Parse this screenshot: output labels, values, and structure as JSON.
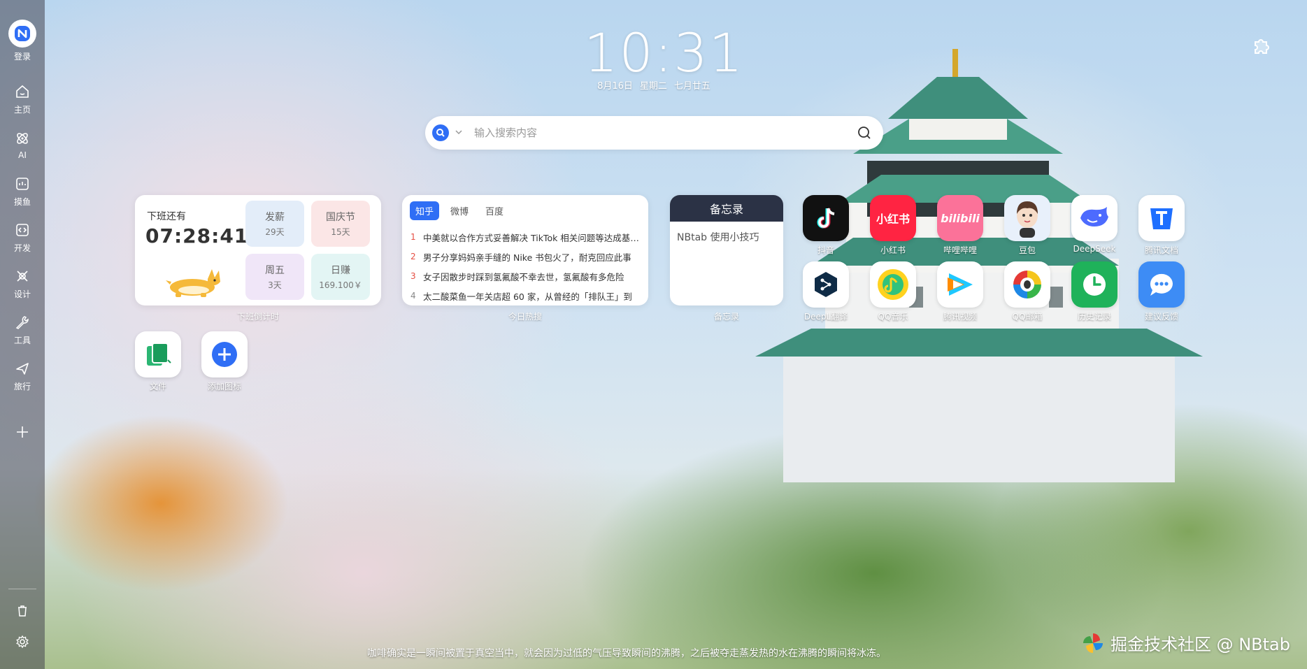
{
  "sidebar": {
    "login_label": "登录",
    "items": [
      {
        "label": "主页",
        "icon": "home-icon"
      },
      {
        "label": "AI",
        "icon": "ai-icon"
      },
      {
        "label": "摸鱼",
        "icon": "fish-icon"
      },
      {
        "label": "开发",
        "icon": "code-icon"
      },
      {
        "label": "设计",
        "icon": "design-icon"
      },
      {
        "label": "工具",
        "icon": "tool-icon"
      },
      {
        "label": "旅行",
        "icon": "plane-icon"
      }
    ]
  },
  "clock": {
    "time": "10:31",
    "date": "8月16日",
    "weekday": "星期二",
    "lunar": "七月廿五"
  },
  "search": {
    "placeholder": "输入搜索内容"
  },
  "countdown": {
    "label": "下班还有",
    "timer": "07:28:41",
    "tiles": [
      {
        "title": "发薪",
        "value": "29天",
        "bg": "#e3edf9"
      },
      {
        "title": "国庆节",
        "value": "15天",
        "bg": "#fbe6e6"
      },
      {
        "title": "周五",
        "value": "3天",
        "bg": "#f0e6f8"
      },
      {
        "title": "日赚",
        "value": "169.100￥",
        "bg": "#e3f5f4"
      }
    ],
    "caption": "下班倒计时"
  },
  "hot": {
    "tabs": [
      "知乎",
      "微博",
      "百度"
    ],
    "items": [
      {
        "num": "1",
        "text": "中美就以合作方式妥善解决 TikTok 相关问题等达成基本框架共识"
      },
      {
        "num": "2",
        "text": "男子分享妈妈亲手缝的 Nike 书包火了，耐克回应此事"
      },
      {
        "num": "3",
        "text": "女子因散步时踩到氢氟酸不幸去世，氢氟酸有多危险"
      },
      {
        "num": "4",
        "text": "太二酸菜鱼一年关店超 60 家，从曾经的「排队王」到"
      }
    ],
    "caption": "今日热搜"
  },
  "memo": {
    "title": "备忘录",
    "content": "NBtab 使用小技巧",
    "caption": "备忘录"
  },
  "apps": [
    {
      "name": "抖音",
      "bg": "#111111"
    },
    {
      "name": "小红书",
      "bg": "#ff2442"
    },
    {
      "name": "哔哩哔哩",
      "bg": "#fb7299"
    },
    {
      "name": "豆包",
      "bg": "#e8f0fb"
    },
    {
      "name": "DeepSeek",
      "bg": "#ffffff"
    },
    {
      "name": "腾讯文档",
      "bg": "#ffffff"
    },
    {
      "name": "DeepL翻译",
      "bg": "#ffffff"
    },
    {
      "name": "QQ音乐",
      "bg": "#ffffff"
    },
    {
      "name": "腾讯视频",
      "bg": "#ffffff"
    },
    {
      "name": "QQ邮箱",
      "bg": "#ffffff"
    },
    {
      "name": "历史记录",
      "bg": "#1fb25a"
    },
    {
      "name": "建议反馈",
      "bg": "#3d8cf5"
    }
  ],
  "bottom_apps": [
    {
      "name": "文件"
    },
    {
      "name": "添加图标"
    }
  ],
  "footer": {
    "quote": "咖啡确实是一瞬间被置于真空当中，就会因为过低的气压导致瞬间的沸腾，之后被夺走蒸发热的水在沸腾的瞬间将冰冻。",
    "watermark": "掘金技术社区 @ NBtab"
  },
  "colors": {
    "accent": "#2f6ef5",
    "memo_header": "#2b3245",
    "hot_number": "#e54d42"
  }
}
